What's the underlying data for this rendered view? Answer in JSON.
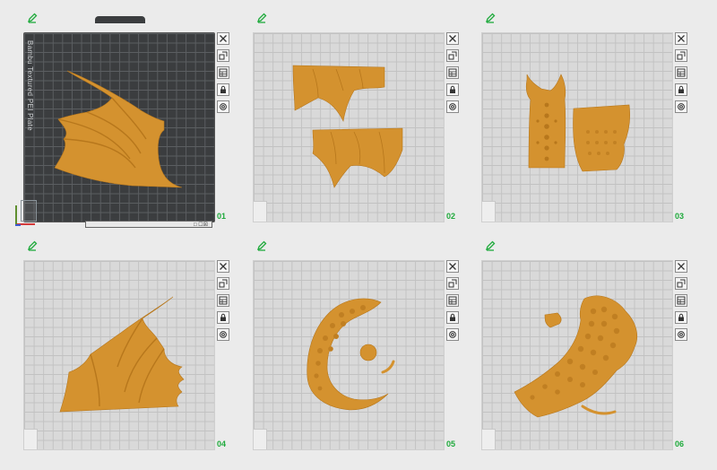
{
  "colors": {
    "accent_green": "#1faa3c",
    "model_orange": "#d4922f",
    "plate_dark": "#3b3d3f",
    "plate_light": "#d9d9d9"
  },
  "plates": [
    {
      "number": "01",
      "label": "Bambu Textured PEI Plate",
      "active": true,
      "status": "□ ☐☒"
    },
    {
      "number": "02",
      "active": false
    },
    {
      "number": "03",
      "active": false
    },
    {
      "number": "04",
      "active": false
    },
    {
      "number": "05",
      "active": false
    },
    {
      "number": "06",
      "active": false
    }
  ],
  "tool_icons": [
    "close-icon",
    "auto-arrange-icon",
    "slice-plate-icon",
    "lock-icon",
    "settings-icon"
  ],
  "edit_icon": "edit-pencil-icon"
}
